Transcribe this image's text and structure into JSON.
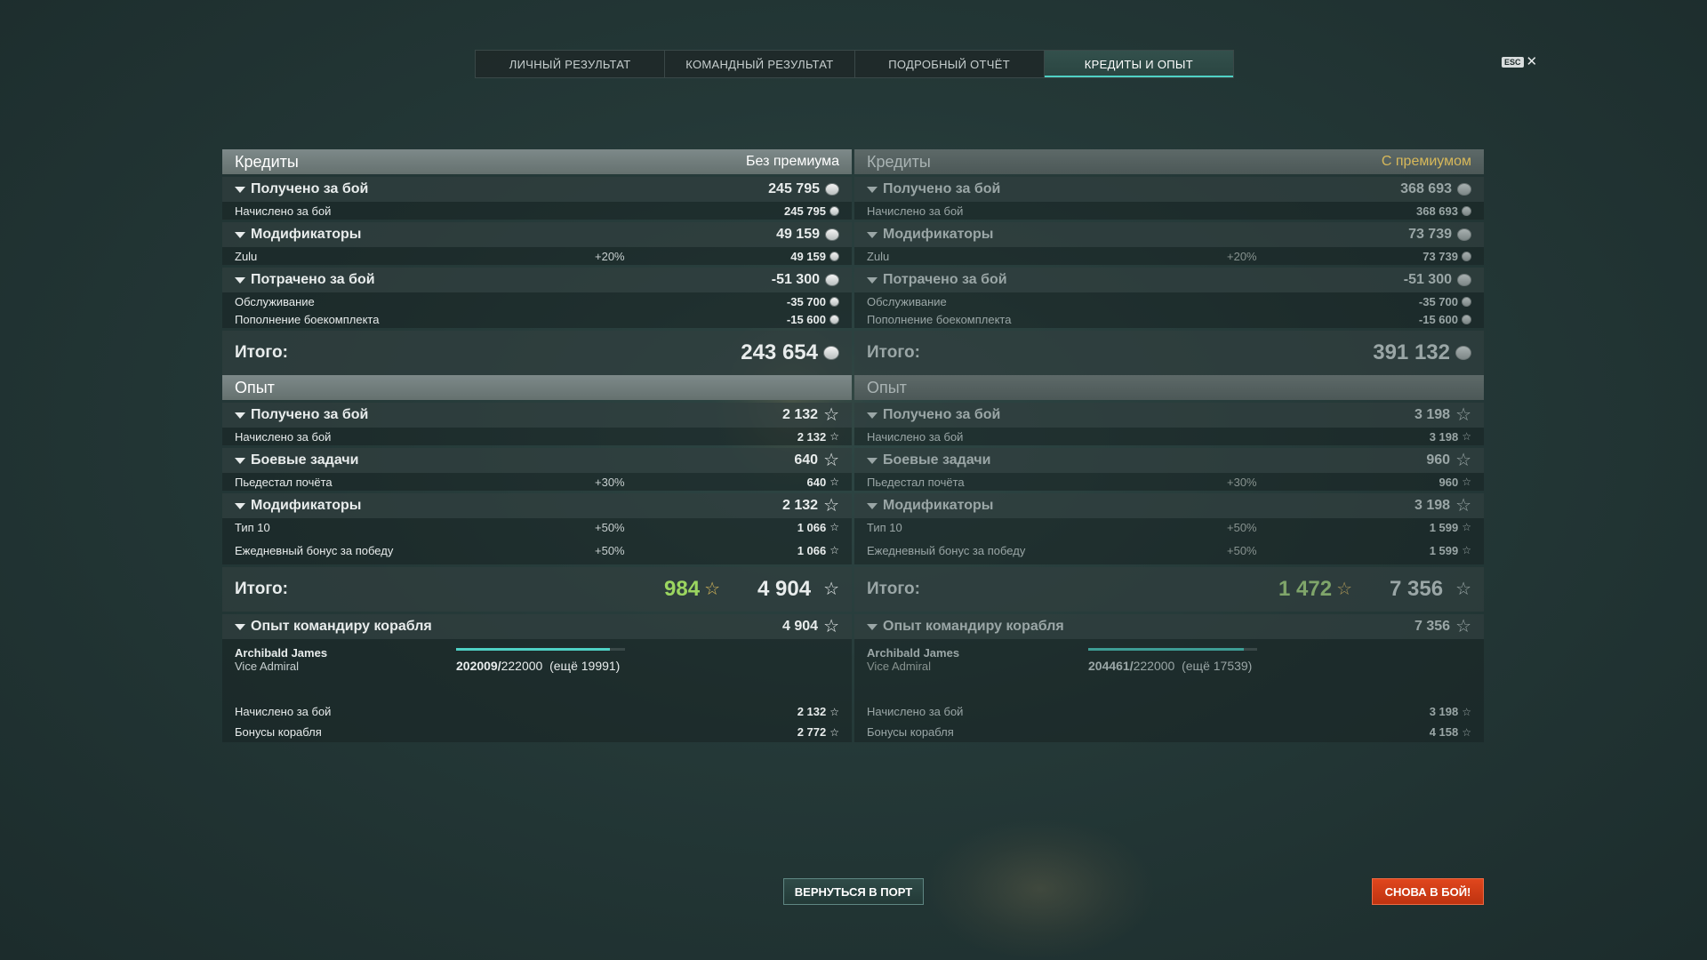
{
  "tabs": [
    {
      "label": "ЛИЧНЫЙ РЕЗУЛЬТАТ"
    },
    {
      "label": "КОМАНДНЫЙ РЕЗУЛЬТАТ"
    },
    {
      "label": "ПОДРОБНЫЙ ОТЧЁТ"
    },
    {
      "label": "КРЕДИТЫ И ОПЫТ",
      "active": true
    }
  ],
  "esc": {
    "key": "ESC",
    "close": "✕"
  },
  "left": {
    "credits_title": "Кредиты",
    "mode": "Без премиума",
    "earned_label": "Получено за бой",
    "earned_value": "245 795",
    "earned_row_label": "Начислено за бой",
    "earned_row_value": "245 795",
    "mod_label": "Модификаторы",
    "mod_value": "49 159",
    "zulu_label": "Zulu",
    "zulu_pct": "+20%",
    "zulu_value": "49 159",
    "spent_label": "Потрачено за бой",
    "spent_value": "-51 300",
    "service_label": "Обслуживание",
    "service_value": "-35 700",
    "ammo_label": "Пополнение боекомплекта",
    "ammo_value": "-15 600",
    "credits_total_label": "Итого:",
    "credits_total_value": "243 654",
    "xp_title": "Опыт",
    "xp_earned_label": "Получено за бой",
    "xp_earned_value": "2 132",
    "xp_earned_row_label": "Начислено за бой",
    "xp_earned_row_value": "2 132",
    "tasks_label": "Боевые задачи",
    "tasks_value": "640",
    "podium_label": "Пьедестал почёта",
    "podium_pct": "+30%",
    "podium_value": "640",
    "xp_mod_label": "Модификаторы",
    "xp_mod_value": "2 132",
    "tier_label": "Тип 10",
    "tier_pct": "+50%",
    "tier_value": "1 066",
    "daily_label": "Ежедневный бонус за победу",
    "daily_pct": "+50%",
    "daily_value": "1 066",
    "xp_total_label": "Итого:",
    "xp_base_total": "984",
    "xp_total": "4 904",
    "cmd_label": "Опыт командиру корабля",
    "cmd_value": "4 904",
    "cmd_name": "Archibald James",
    "cmd_rank": "Vice Admiral",
    "cmd_progress_current": "202009",
    "cmd_progress_sep": "/",
    "cmd_progress_max": "222000",
    "cmd_progress_remaining": "(ещё 19991)",
    "cmd_progress_fraction": 0.91,
    "cmd_earned_label": "Начислено за бой",
    "cmd_earned_value": "2 132",
    "cmd_bonus_label": "Бонусы корабля",
    "cmd_bonus_value": "2 772"
  },
  "right": {
    "credits_title": "Кредиты",
    "mode": "С премиумом",
    "earned_label": "Получено за бой",
    "earned_value": "368 693",
    "earned_row_label": "Начислено за бой",
    "earned_row_value": "368 693",
    "mod_label": "Модификаторы",
    "mod_value": "73 739",
    "zulu_label": "Zulu",
    "zulu_pct": "+20%",
    "zulu_value": "73 739",
    "spent_label": "Потрачено за бой",
    "spent_value": "-51 300",
    "service_label": "Обслуживание",
    "service_value": "-35 700",
    "ammo_label": "Пополнение боекомплекта",
    "ammo_value": "-15 600",
    "credits_total_label": "Итого:",
    "credits_total_value": "391 132",
    "xp_title": "Опыт",
    "xp_earned_label": "Получено за бой",
    "xp_earned_value": "3 198",
    "xp_earned_row_label": "Начислено за бой",
    "xp_earned_row_value": "3 198",
    "tasks_label": "Боевые задачи",
    "tasks_value": "960",
    "podium_label": "Пьедестал почёта",
    "podium_pct": "+30%",
    "podium_value": "960",
    "xp_mod_label": "Модификаторы",
    "xp_mod_value": "3 198",
    "tier_label": "Тип 10",
    "tier_pct": "+50%",
    "tier_value": "1 599",
    "daily_label": "Ежедневный бонус за победу",
    "daily_pct": "+50%",
    "daily_value": "1 599",
    "xp_total_label": "Итого:",
    "xp_base_total": "1 472",
    "xp_total": "7 356",
    "cmd_label": "Опыт командиру корабля",
    "cmd_value": "7 356",
    "cmd_name": "Archibald James",
    "cmd_rank": "Vice Admiral",
    "cmd_progress_current": "204461",
    "cmd_progress_sep": "/",
    "cmd_progress_max": "222000",
    "cmd_progress_remaining": "(ещё 17539)",
    "cmd_progress_fraction": 0.92,
    "cmd_earned_label": "Начислено за бой",
    "cmd_earned_value": "3 198",
    "cmd_bonus_label": "Бонусы корабля",
    "cmd_bonus_value": "4 158"
  },
  "buttons": {
    "port": "ВЕРНУТЬСЯ В ПОРТ",
    "battle": "СНОВА В БОЙ!"
  },
  "icons": {
    "credit": "credit-coin-icon",
    "xp": "xp-star-icon"
  },
  "colors": {
    "accent": "#4fd1c5",
    "battle_button": "#d63d16",
    "xp_base_green": "#9bd560",
    "premium_label": "#d7b85a"
  }
}
